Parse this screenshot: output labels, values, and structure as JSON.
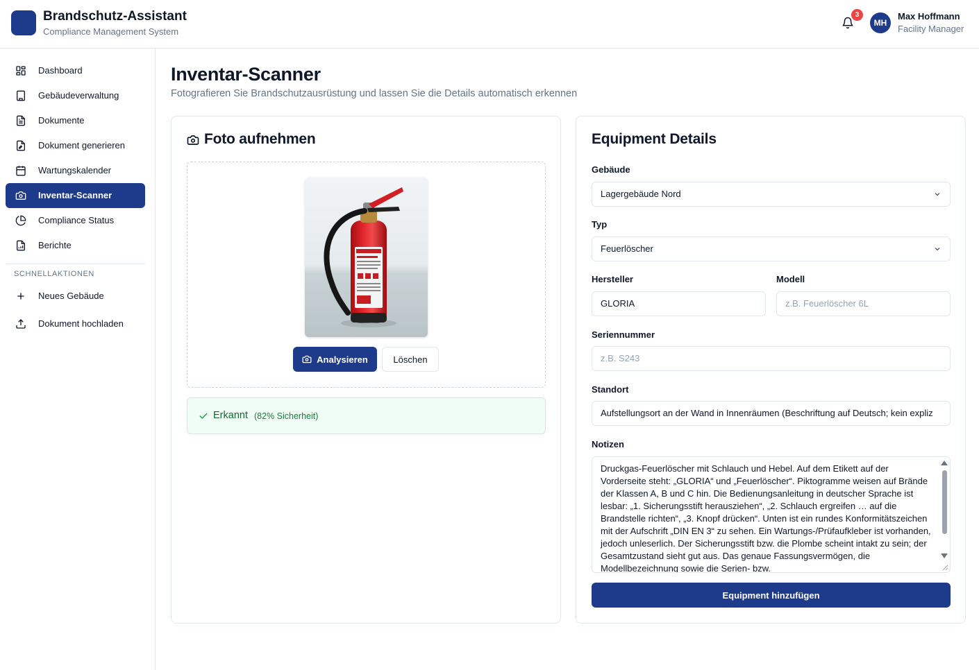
{
  "header": {
    "app_title": "Brandschutz-Assistant",
    "app_subtitle": "Compliance Management System",
    "notification_count": "3",
    "user_initials": "MH",
    "user_name": "Max Hoffmann",
    "user_role": "Facility Manager"
  },
  "sidebar": {
    "items": [
      {
        "label": "Dashboard",
        "icon": "dashboard-icon"
      },
      {
        "label": "Gebäudeverwaltung",
        "icon": "building-icon"
      },
      {
        "label": "Dokumente",
        "icon": "document-icon"
      },
      {
        "label": "Dokument generieren",
        "icon": "document-generate-icon"
      },
      {
        "label": "Wartungskalender",
        "icon": "calendar-icon"
      },
      {
        "label": "Inventar-Scanner",
        "icon": "camera-icon",
        "active": true
      },
      {
        "label": "Compliance Status",
        "icon": "pie-chart-icon"
      },
      {
        "label": "Berichte",
        "icon": "report-icon"
      }
    ],
    "section_label": "SCHNELLAKTIONEN",
    "quick_actions": [
      {
        "label": "Neues Gebäude",
        "icon": "plus-icon"
      },
      {
        "label": "Dokument hochladen",
        "icon": "upload-icon"
      }
    ]
  },
  "main": {
    "title": "Inventar-Scanner",
    "subtitle": "Fotografieren Sie Brandschutzausrüstung und lassen Sie die Details automatisch erkennen"
  },
  "photo_card": {
    "title": "Foto aufnehmen",
    "analyze_label": "Analysieren",
    "delete_label": "Löschen",
    "detected_label": "Erkannt",
    "confidence_text": "(82% Sicherheit)"
  },
  "details_card": {
    "title": "Equipment Details",
    "building_label": "Gebäude",
    "building_value": "Lagergebäude Nord",
    "type_label": "Typ",
    "type_value": "Feuerlöscher",
    "manufacturer_label": "Hersteller",
    "manufacturer_value": "GLORIA",
    "model_label": "Modell",
    "model_placeholder": "z.B. Feuerlöscher 6L",
    "serial_label": "Seriennummer",
    "serial_placeholder": "z.B. S243",
    "location_label": "Standort",
    "location_value": "Aufstellungsort an der Wand in Innenräumen (Beschriftung auf Deutsch; kein expliz",
    "notes_label": "Notizen",
    "notes_value": "Druckgas-Feuerlöscher mit Schlauch und Hebel. Auf dem Etikett auf der Vorderseite steht: „GLORIA“ und „Feuerlöscher“. Piktogramme weisen auf Brände der Klassen A, B und C hin. Die Bedienungsanleitung in deutscher Sprache ist lesbar: „1. Sicherungsstift herausziehen“, „2. Schlauch ergreifen … auf die Brandstelle richten“, „3. Knopf drücken“. Unten ist ein rundes Konformitätszeichen mit der Aufschrift „DIN EN 3“ zu sehen. Ein Wartungs-/Prüfaufkleber ist vorhanden, jedoch unleserlich. Der Sicherungsstift bzw. die Plombe scheint intakt zu sein; der Gesamtzustand sieht gut aus. Das genaue Fassungsvermögen, die Modellbezeichnung sowie die Serien- bzw.",
    "submit_label": "Equipment hinzufügen"
  },
  "colors": {
    "primary": "#1e3a8a",
    "badge": "#ef4444",
    "success_text": "#166534",
    "success_bg": "#f0fdf4"
  }
}
